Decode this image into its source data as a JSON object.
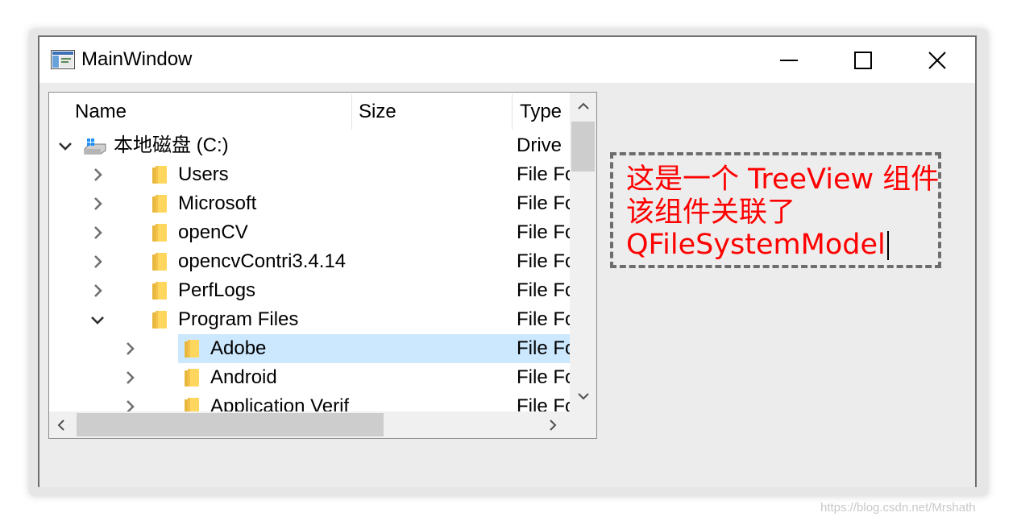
{
  "window": {
    "title": "MainWindow"
  },
  "tree": {
    "columns": [
      "Name",
      "Size",
      "Type"
    ],
    "rows": [
      {
        "name": "本地磁盘 (C:)",
        "type": "Drive",
        "level": 0,
        "expanded": true,
        "icon": "drive-icon"
      },
      {
        "name": "Users",
        "type": "File Fo",
        "level": 1,
        "expanded": false,
        "icon": "folder-icon"
      },
      {
        "name": "Microsoft",
        "type": "File Fo",
        "level": 1,
        "expanded": false,
        "icon": "folder-icon"
      },
      {
        "name": "openCV",
        "type": "File Fo",
        "level": 1,
        "expanded": false,
        "icon": "folder-icon"
      },
      {
        "name": "opencvContri3.4.14",
        "type": "File Fo",
        "level": 1,
        "expanded": false,
        "icon": "folder-icon"
      },
      {
        "name": "PerfLogs",
        "type": "File Fo",
        "level": 1,
        "expanded": false,
        "icon": "folder-icon"
      },
      {
        "name": "Program Files",
        "type": "File Fo",
        "level": 1,
        "expanded": true,
        "icon": "folder-icon"
      },
      {
        "name": "Adobe",
        "type": "File Fo",
        "level": 2,
        "expanded": false,
        "icon": "folder-icon",
        "selected": true
      },
      {
        "name": "Android",
        "type": "File Fo",
        "level": 2,
        "expanded": false,
        "icon": "folder-icon"
      },
      {
        "name": "Application Verif",
        "type": "File Fo",
        "level": 2,
        "expanded": false,
        "icon": "folder-icon"
      }
    ],
    "selection_color": "#cce8ff"
  },
  "annotation": {
    "lines": [
      "这是一个 TreeView 组件",
      "该组件关联了",
      "QFileSystemModel"
    ],
    "color": "#ff0000"
  },
  "watermark": "https://blog.csdn.net/Mrshath"
}
